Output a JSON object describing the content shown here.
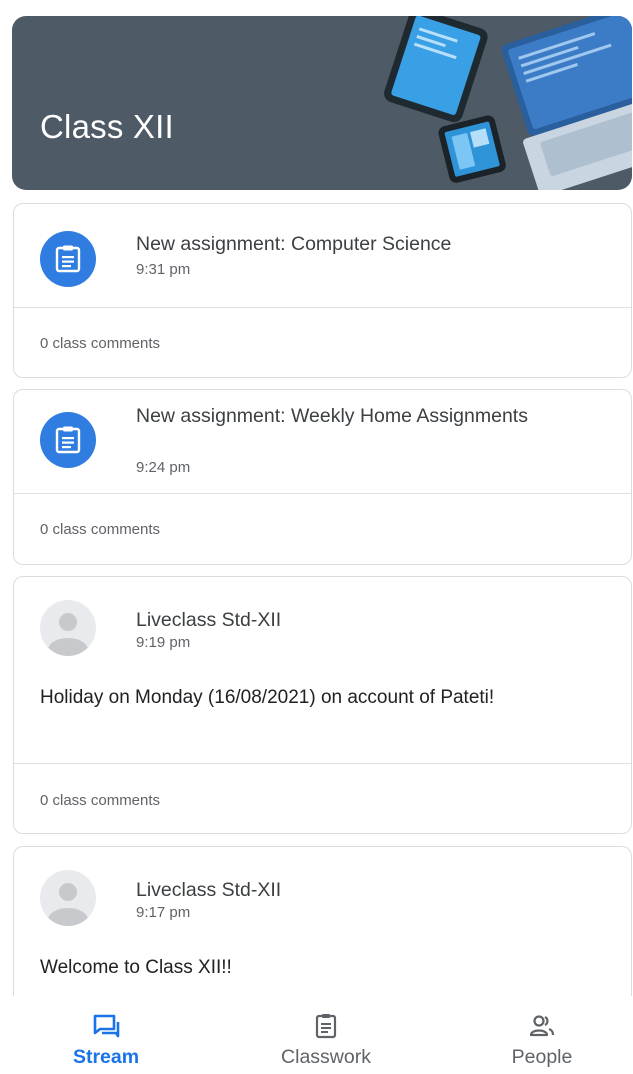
{
  "header": {
    "class_name": "Class XII"
  },
  "stream": [
    {
      "kind": "assignment",
      "title": "New assignment: Computer Science",
      "time": "9:31 pm",
      "comments": "0 class comments"
    },
    {
      "kind": "assignment",
      "title": "New assignment: Weekly Home Assignments",
      "time": "9:24 pm",
      "comments": "0 class comments"
    },
    {
      "kind": "announcement",
      "author": "Liveclass Std-XII",
      "time": "9:19 pm",
      "body": "Holiday on Monday (16/08/2021) on account of Pateti!",
      "comments": "0 class comments"
    },
    {
      "kind": "announcement",
      "author": "Liveclass Std-XII",
      "time": "9:17 pm",
      "body": "Welcome to Class XII!!"
    }
  ],
  "nav": {
    "items": [
      {
        "label": "Stream",
        "icon": "stream-icon",
        "active": true
      },
      {
        "label": "Classwork",
        "icon": "classwork-icon",
        "active": false
      },
      {
        "label": "People",
        "icon": "people-icon",
        "active": false
      }
    ]
  },
  "colors": {
    "accent": "#1a73e8",
    "banner": "#4e5a65",
    "assignment_avatar": "#2f7de1"
  }
}
